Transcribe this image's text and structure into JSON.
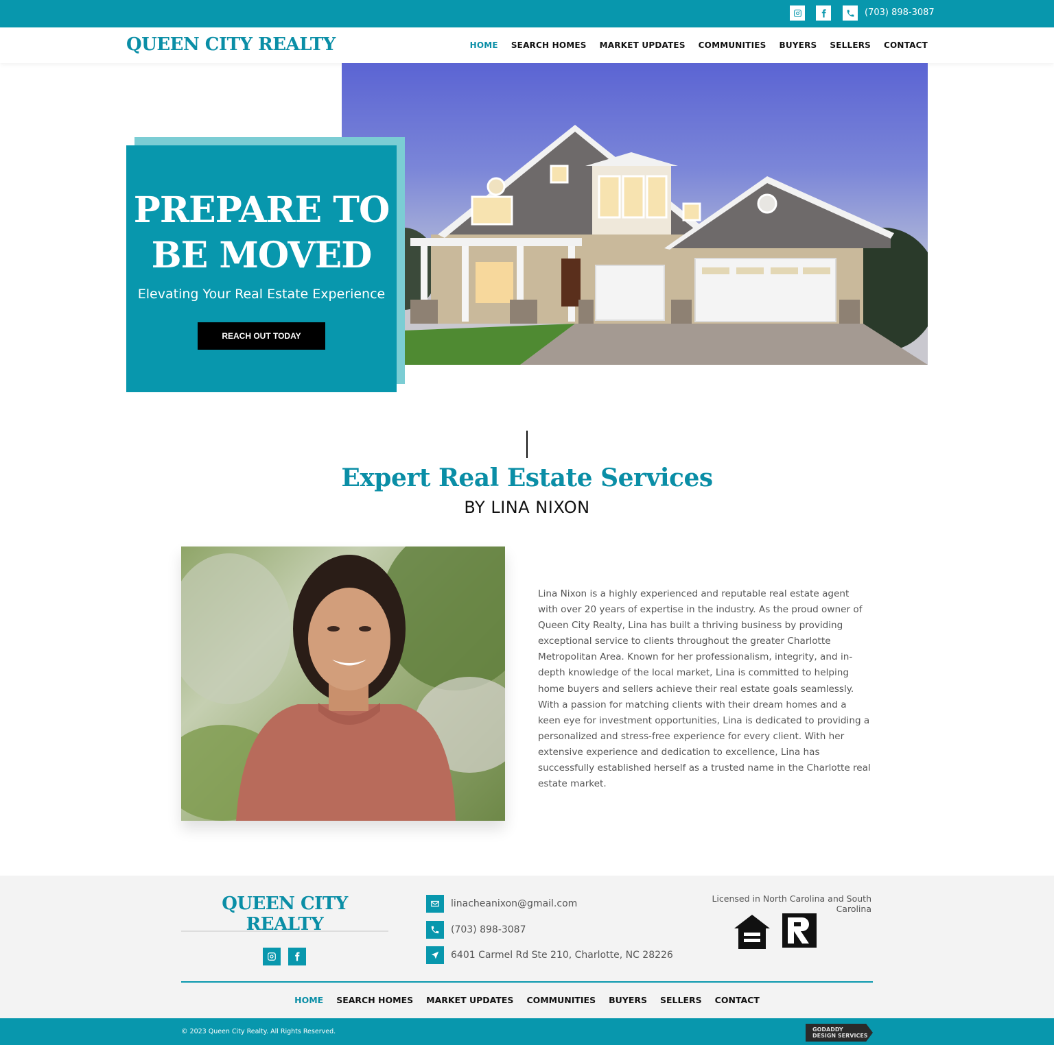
{
  "topbar": {
    "phone": "(703) 898-3087",
    "icons": [
      "instagram-icon",
      "facebook-icon",
      "phone-icon"
    ]
  },
  "header": {
    "logo": "QUEEN CITY REALTY",
    "nav": [
      "HOME",
      "SEARCH HOMES",
      "MARKET UPDATES",
      "COMMUNITIES",
      "BUYERS",
      "SELLERS",
      "CONTACT"
    ],
    "active": "HOME"
  },
  "hero": {
    "title_line1": "PREPARE TO",
    "title_line2": "BE MOVED",
    "subtitle": "Elevating Your Real Estate Experience",
    "cta": "REACH OUT TODAY"
  },
  "intro": {
    "title": "Expert Real Estate Services",
    "subtitle": "BY LINA NIXON",
    "bio": "Lina Nixon is a highly experienced and reputable real estate agent with over 20 years of expertise in the industry. As the proud owner of Queen City Realty, Lina has built a thriving business by providing exceptional service to clients throughout the greater Charlotte Metropolitan Area. Known for her professionalism, integrity, and in-depth knowledge of the local market, Lina is committed to helping home buyers and sellers achieve their real estate goals seamlessly. With a passion for matching clients with their dream homes and a keen eye for investment opportunities, Lina is dedicated to providing a personalized and stress-free experience for every client. With her extensive experience and dedication to excellence, Lina has successfully established herself as a trusted name in the Charlotte real estate market."
  },
  "footer": {
    "logo": "QUEEN CITY REALTY",
    "email": "linacheanixon@gmail.com",
    "phone": "(703) 898-3087",
    "address": "6401 Carmel Rd Ste 210, Charlotte, NC 28226",
    "license": "Licensed in North Carolina and South Carolina",
    "eho_text": "EQUAL HOUSING OPPORTUNITY",
    "realtor_text": "REALTOR",
    "nav": [
      "HOME",
      "SEARCH HOMES",
      "MARKET UPDATES",
      "COMMUNITIES",
      "BUYERS",
      "SELLERS",
      "CONTACT"
    ],
    "copyright": "© 2023 Queen City Realty. All Rights Reserved.",
    "badge_line1": "GODADDY",
    "badge_line2": "DESIGN SERVICES"
  },
  "colors": {
    "brand": "#0897ad",
    "accent_light": "#7bcdd4",
    "button": "#000000"
  }
}
